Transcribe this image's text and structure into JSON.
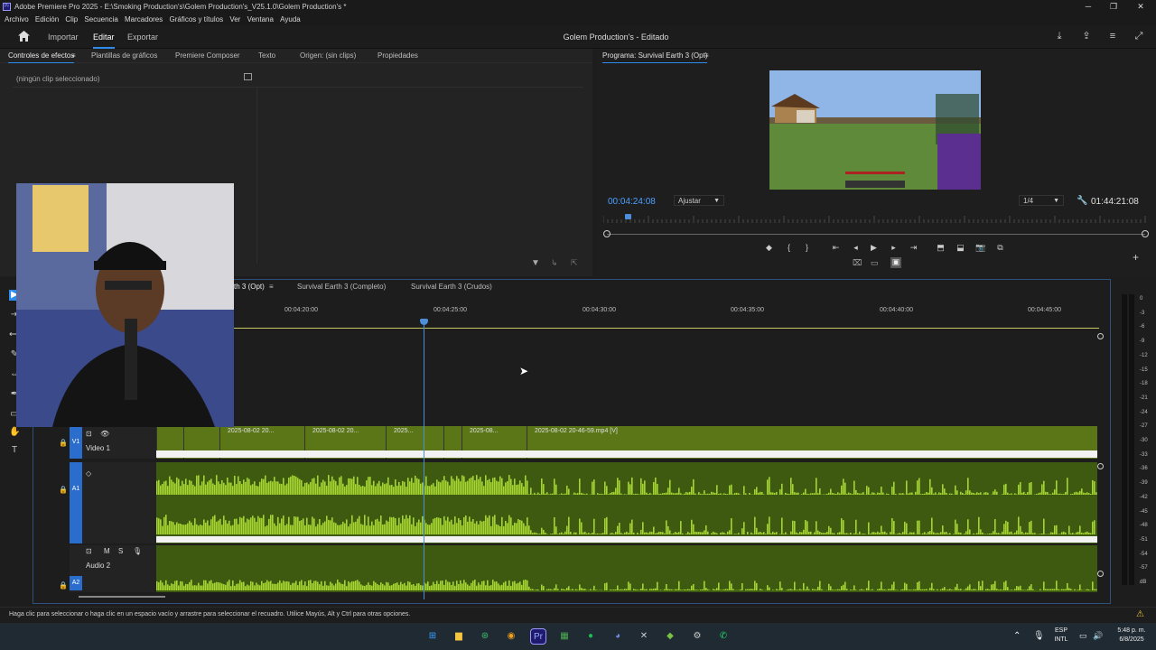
{
  "titlebar": {
    "title": "Adobe Premiere Pro 2025 - E:\\Smoking Production's\\Golem Production's_V25.1.0\\Golem Production's *",
    "app_icon": "Pr"
  },
  "menu": [
    "Archivo",
    "Edición",
    "Clip",
    "Secuencia",
    "Marcadores",
    "Gráficos y títulos",
    "Ver",
    "Ventana",
    "Ayuda"
  ],
  "header": {
    "workspaces": [
      "Importar",
      "Editar",
      "Exportar"
    ],
    "active": "Editar",
    "project": "Golem Production's - Editado"
  },
  "effects_panel": {
    "tabs": [
      "Controles de efectos",
      "Plantillas de gráficos",
      "Premiere Composer",
      "Texto",
      "Origen: (sin clips)",
      "Propiedades"
    ],
    "no_clip": "(ningún clip seleccionado)"
  },
  "program": {
    "label": "Programa: Survival Earth 3 (Opt)",
    "timecode": "00:04:24:08",
    "fit": "Ajustar",
    "resolution": "1/4",
    "duration": "01:44:21:08",
    "playhead_fraction": 0.04
  },
  "timeline": {
    "tabs": [
      "Survival Earth 3 (Opt)",
      "Survival Earth 3 (Completo)",
      "Survival Earth 3 (Crudos)"
    ],
    "tab_visible_parts": [
      "th 3 (Opt)"
    ],
    "ruler": [
      "00:04:20:00",
      "00:04:25:00",
      "00:04:30:00",
      "00:04:35:00",
      "00:04:40:00",
      "00:04:45:00"
    ],
    "tracks": {
      "v1": "V1",
      "video1": "Video 1",
      "a1": "A1",
      "a2": "A2",
      "audio2": "Audio 2"
    },
    "clips": [
      "2025-08-02 20...",
      "2025-08-02 20...",
      "2025...",
      "2025-08...",
      "2025-08-02 20-46-59.mp4 [V]"
    ],
    "header_glyphs": {
      "mute": "M",
      "solo": "S",
      "lock": "🔒",
      "eye": "👁",
      "fx": "fx"
    }
  },
  "meters": [
    "0",
    "-3",
    "-6",
    "-9",
    "-12",
    "-15",
    "-18",
    "-21",
    "-24",
    "-27",
    "-30",
    "-33",
    "-36",
    "-39",
    "-42",
    "-45",
    "-48",
    "-51",
    "-54",
    "-57",
    "dB"
  ],
  "status": "Haga clic para seleccionar o haga clic en un espacio vacío y arrastre para seleccionar el recuadro. Utilice Mayús, Alt y Ctrl para otras opciones.",
  "taskbar": {
    "lang1": "ESP",
    "lang2": "INTL",
    "time": "5:48 p. m.",
    "date": "6/8/2025"
  },
  "colors": {
    "accent": "#2d8ceb",
    "clip": "#5b7617",
    "wave": "#a6d531",
    "timecode": "#4aa0ff"
  }
}
